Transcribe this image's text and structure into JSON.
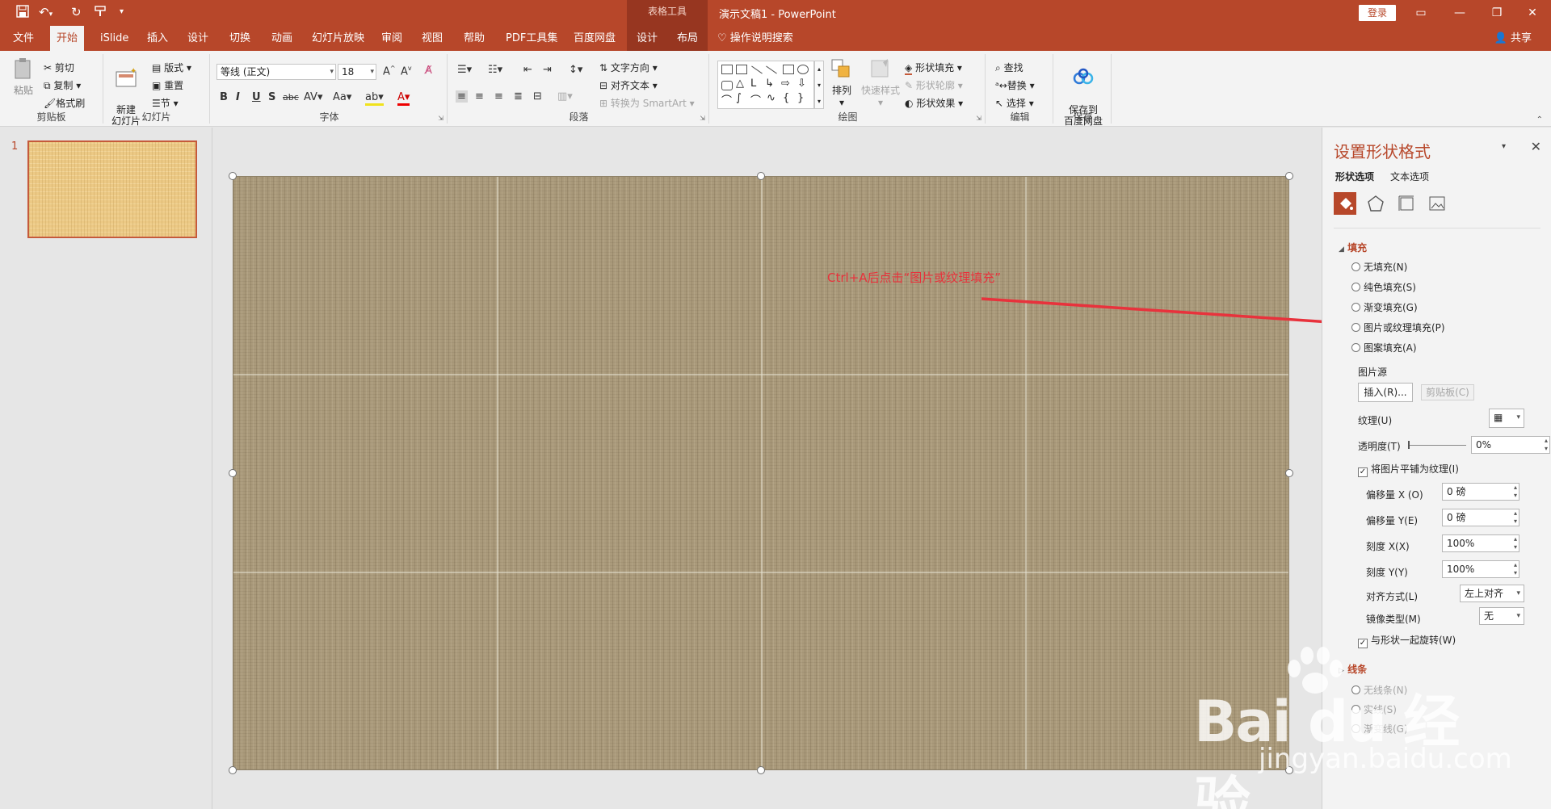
{
  "titlebar": {
    "context_tab": "表格工具",
    "doc_title": "演示文稿1  -  PowerPoint",
    "login": "登录",
    "quick_access": [
      "save-icon",
      "undo-icon",
      "redo-icon",
      "format-painter-icon",
      "customize-icon"
    ]
  },
  "tabs": {
    "items": [
      "文件",
      "开始",
      "iSlide",
      "插入",
      "设计",
      "切换",
      "动画",
      "幻灯片放映",
      "审阅",
      "视图",
      "帮助",
      "PDF工具集",
      "百度网盘",
      "设计",
      "布局"
    ],
    "active": "开始",
    "tell_me": "操作说明搜索",
    "share": "共享"
  },
  "ribbon": {
    "clipboard": {
      "label": "剪贴板",
      "paste": "粘贴",
      "cut": "剪切",
      "copy": "复制",
      "format_painter": "格式刷"
    },
    "slides": {
      "label": "幻灯片",
      "new_slide": "新建\n幻灯片",
      "layout": "版式",
      "reset": "重置",
      "section": "节"
    },
    "font": {
      "label": "字体",
      "font_name": "等线 (正文)",
      "font_size": "18"
    },
    "paragraph": {
      "label": "段落",
      "text_direction": "文字方向",
      "align_text": "对齐文本",
      "convert_smartart": "转换为 SmartArt"
    },
    "drawing": {
      "label": "绘图",
      "arrange": "排列",
      "quick_styles": "快速样式",
      "shape_fill": "形状填充",
      "shape_outline": "形状轮廓",
      "shape_effects": "形状效果"
    },
    "editing": {
      "label": "编辑",
      "find": "查找",
      "replace": "替换",
      "select": "选择"
    },
    "save": {
      "label": "保存",
      "save_to": "保存到\n百度网盘"
    }
  },
  "thumbnails": {
    "slide_number": "1"
  },
  "canvas": {
    "annotation": "Ctrl+A后点击“图片或纹理填充”",
    "annotation_color": "#e8323c",
    "slide_texture": "burlap-canvas"
  },
  "format_pane": {
    "title": "设置形状格式",
    "subtabs": [
      "形状选项",
      "文本选项"
    ],
    "fill_section": "填充",
    "fill_options": [
      "无填充(N)",
      "纯色填充(S)",
      "渐变填充(G)",
      "图片或纹理填充(P)",
      "图案填充(A)"
    ],
    "picture_source": "图片源",
    "insert_btn": "插入(R)...",
    "clipboard_btn": "剪贴板(C)",
    "texture": "纹理(U)",
    "transparency": "透明度(T)",
    "transparency_value": "0%",
    "tile": "将图片平铺为纹理(I)",
    "offset_x": "偏移量 X (O)",
    "offset_x_value": "0 磅",
    "offset_y": "偏移量 Y(E)",
    "offset_y_value": "0 磅",
    "scale_x": "刻度 X(X)",
    "scale_x_value": "100%",
    "scale_y": "刻度 Y(Y)",
    "scale_y_value": "100%",
    "alignment": "对齐方式(L)",
    "alignment_value": "左上对齐",
    "mirror": "镜像类型(M)",
    "mirror_value": "无",
    "rotate_with_shape": "与形状一起旋转(W)",
    "line_section": "线条",
    "line_options": [
      "无线条(N)",
      "实线(S)",
      "渐变线(G)"
    ]
  },
  "watermark": {
    "main": "Bai du 经验",
    "url": "jingyan.baidu.com"
  }
}
